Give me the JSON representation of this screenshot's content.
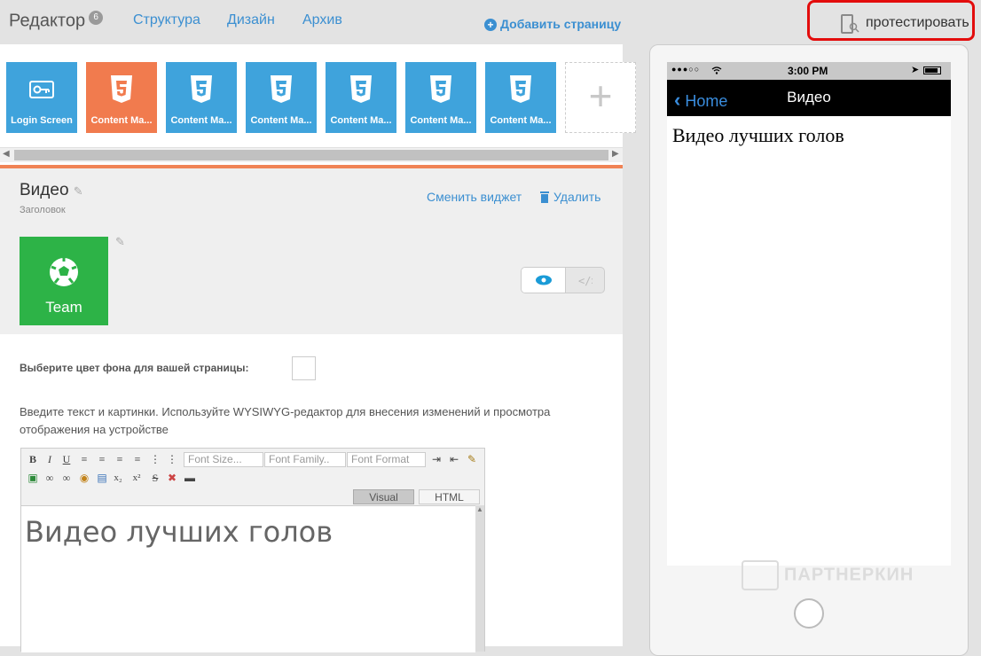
{
  "nav": {
    "editor_label": "Редактор",
    "editor_badge": "6",
    "structure_label": "Структура",
    "design_label": "Дизайн",
    "archive_label": "Архив",
    "add_page_label": "Добавить страницу",
    "test_label": "протестировать"
  },
  "tiles": [
    {
      "label": "Login Screen",
      "icon": "key-icon",
      "color": "#3fa3dc"
    },
    {
      "label": "Content Ma...",
      "icon": "html5-icon",
      "color": "#f17b4e"
    },
    {
      "label": "Content Ma...",
      "icon": "html5-icon",
      "color": "#3fa3dc"
    },
    {
      "label": "Content Ma...",
      "icon": "html5-icon",
      "color": "#3fa3dc"
    },
    {
      "label": "Content Ma...",
      "icon": "html5-icon",
      "color": "#3fa3dc"
    },
    {
      "label": "Content Ma...",
      "icon": "html5-icon",
      "color": "#3fa3dc"
    },
    {
      "label": "Content Ma...",
      "icon": "html5-icon",
      "color": "#3fa3dc"
    }
  ],
  "widget": {
    "title": "Видео",
    "subtitle": "Заголовок",
    "change_label": "Сменить виджет",
    "delete_label": "Удалить",
    "team_label": "Team"
  },
  "form": {
    "bg_color_label": "Выберите цвет фона для вашей страницы:",
    "instructions": "Введите текст и картинки. Используйте WYSIWYG-редактор для внесения изменений и просмотра отображения на устройстве"
  },
  "editor": {
    "font_size_placeholder": "Font Size...",
    "font_family_placeholder": "Font Family..",
    "font_format_placeholder": "Font Format",
    "tab_visual": "Visual",
    "tab_html": "HTML",
    "content": "Видео лучших голов"
  },
  "phone": {
    "carrier": "●●●○○",
    "time": "3:00 PM",
    "back_label": "Home",
    "nav_title": "Видео",
    "content": "Видео лучших голов",
    "watermark": "ПАРТНЕРКИН"
  },
  "colors": {
    "accent_blue": "#3b8fd1",
    "accent_orange": "#f08355",
    "team_green": "#2db347",
    "highlight_red": "#e30d0d"
  }
}
